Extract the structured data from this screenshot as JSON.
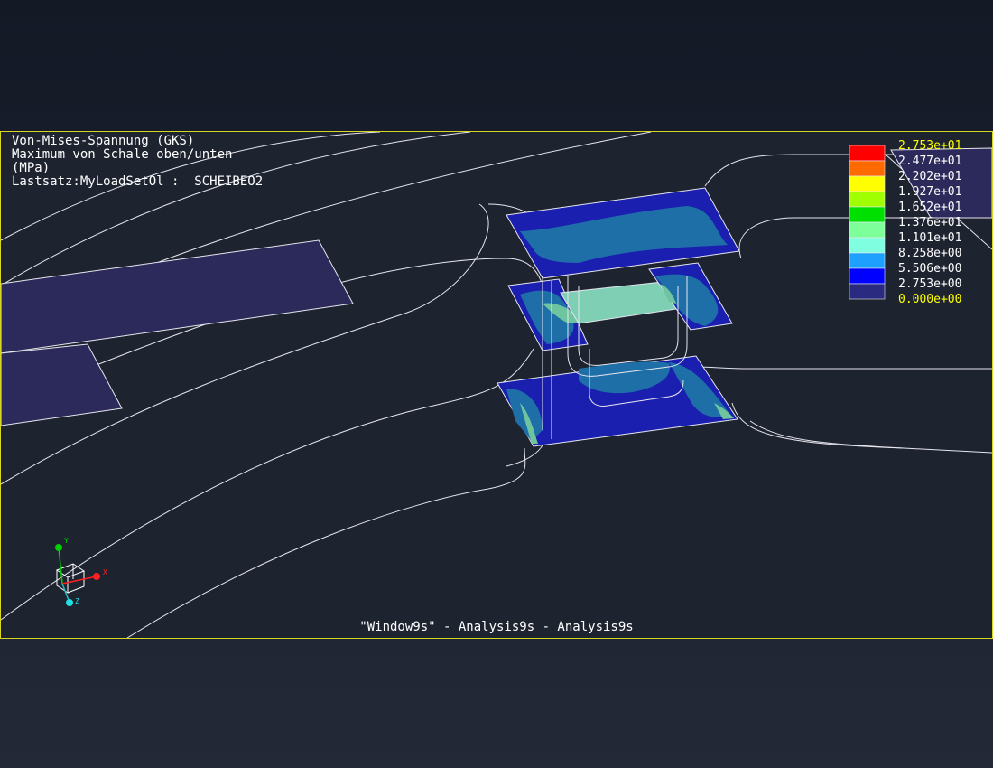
{
  "header": {
    "line1": "Von-Mises-Spannung (GKS)",
    "line2": "Maximum von Schale oben/unten",
    "line3": "(MPa)",
    "line4": "Lastsatz:MyLoadSetOl :  SCHEIBEO2"
  },
  "legend": {
    "labels": [
      "2.753e+01",
      "2.477e+01",
      "2.202e+01",
      "1.927e+01",
      "1.652e+01",
      "1.376e+01",
      "1.101e+01",
      "8.258e+00",
      "5.506e+00",
      "2.753e+00",
      "0.000e+00"
    ],
    "colors": [
      "#ff0000",
      "#ff6a00",
      "#ffff00",
      "#a0ff00",
      "#00e000",
      "#7dff9a",
      "#80ffe0",
      "#1ea0ff",
      "#0000ff",
      "#2a2a80"
    ]
  },
  "triad": {
    "x": "X",
    "y": "Y",
    "z": "Z"
  },
  "footer": {
    "title": "\"Window9s\" - Analysis9s - Analysis9s"
  },
  "colors": {
    "frame": "#d8d820",
    "background": "#1e2330",
    "stress_low": "#1a1fb0",
    "stress_mid": "#1e6fa8",
    "surface_flat": "#2c2a5a"
  }
}
